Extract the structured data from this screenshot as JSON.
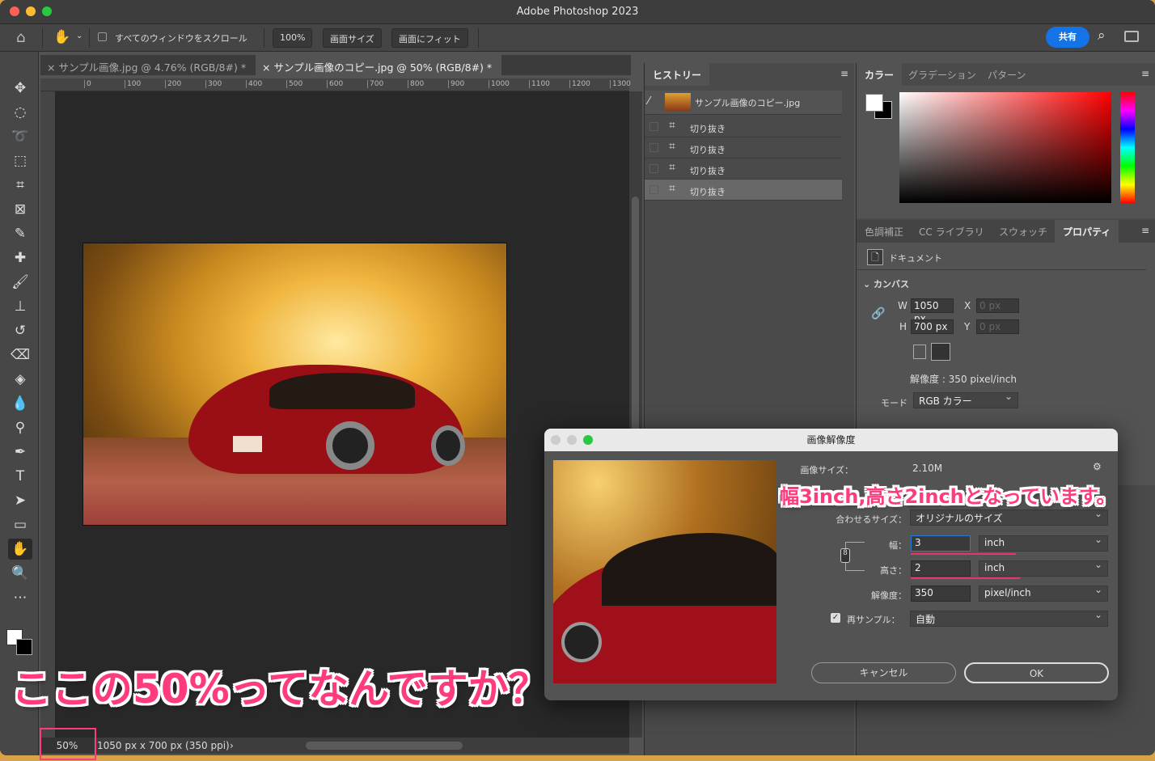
{
  "app": {
    "title": "Adobe Photoshop 2023"
  },
  "options": {
    "scroll_all_label": "すべてのウィンドウをスクロール",
    "zoom100": "100%",
    "screen_size": "画面サイズ",
    "fit_screen": "画面にフィット",
    "share": "共有"
  },
  "tabs": [
    {
      "label": "サンプル画像.jpg @ 4.76% (RGB/8#) *",
      "active": false
    },
    {
      "label": "サンプル画像のコピー.jpg @ 50% (RGB/8#) *",
      "active": true
    }
  ],
  "ruler": {
    "top": [
      "0",
      "100",
      "200",
      "300",
      "400",
      "500",
      "600",
      "700",
      "800",
      "900",
      "1000",
      "1100",
      "1200",
      "1300"
    ]
  },
  "status": {
    "zoom": "50%",
    "doc_info": "1050 px x 700 px (350 ppi)",
    "arrow": "›"
  },
  "history": {
    "tab": "ヒストリー",
    "snapshot": "サンプル画像のコピー.jpg",
    "items": [
      "切り抜き",
      "切り抜き",
      "切り抜き",
      "切り抜き"
    ]
  },
  "color_panel": {
    "tabs": [
      "カラー",
      "グラデーション",
      "パターン"
    ]
  },
  "props_panel": {
    "tabs": [
      "色調補正",
      "CC ライブラリ",
      "スウォッチ",
      "プロパティ"
    ],
    "doc_label": "ドキュメント",
    "section": "カンバス",
    "w_label": "W",
    "w": "1050 px",
    "h_label": "H",
    "h": "700 px",
    "x_label": "X",
    "x": "0 px",
    "y_label": "Y",
    "y": "0 px",
    "resolution": "解像度 : 350 pixel/inch",
    "mode_label": "モード",
    "mode": "RGB カラー"
  },
  "dialog": {
    "title": "画像解像度",
    "image_size_label": "画像サイズ：",
    "image_size": "2.10M",
    "fit_label": "合わせるサイズ：",
    "fit_value": "オリジナルのサイズ",
    "width_label": "幅：",
    "width": "3",
    "width_unit": "inch",
    "height_label": "高さ：",
    "height": "2",
    "height_unit": "inch",
    "res_label": "解像度：",
    "res": "350",
    "res_unit": "pixel/inch",
    "resample_label": "再サンプル：",
    "resample_checked": true,
    "resample": "自動",
    "cancel": "キャンセル",
    "ok": "OK"
  },
  "annotations": {
    "dialog_note": "幅3inch,高さ2inchとなっています。",
    "zoom_question": "ここの50%ってなんですか？",
    "accent": "#ff3b7f"
  }
}
